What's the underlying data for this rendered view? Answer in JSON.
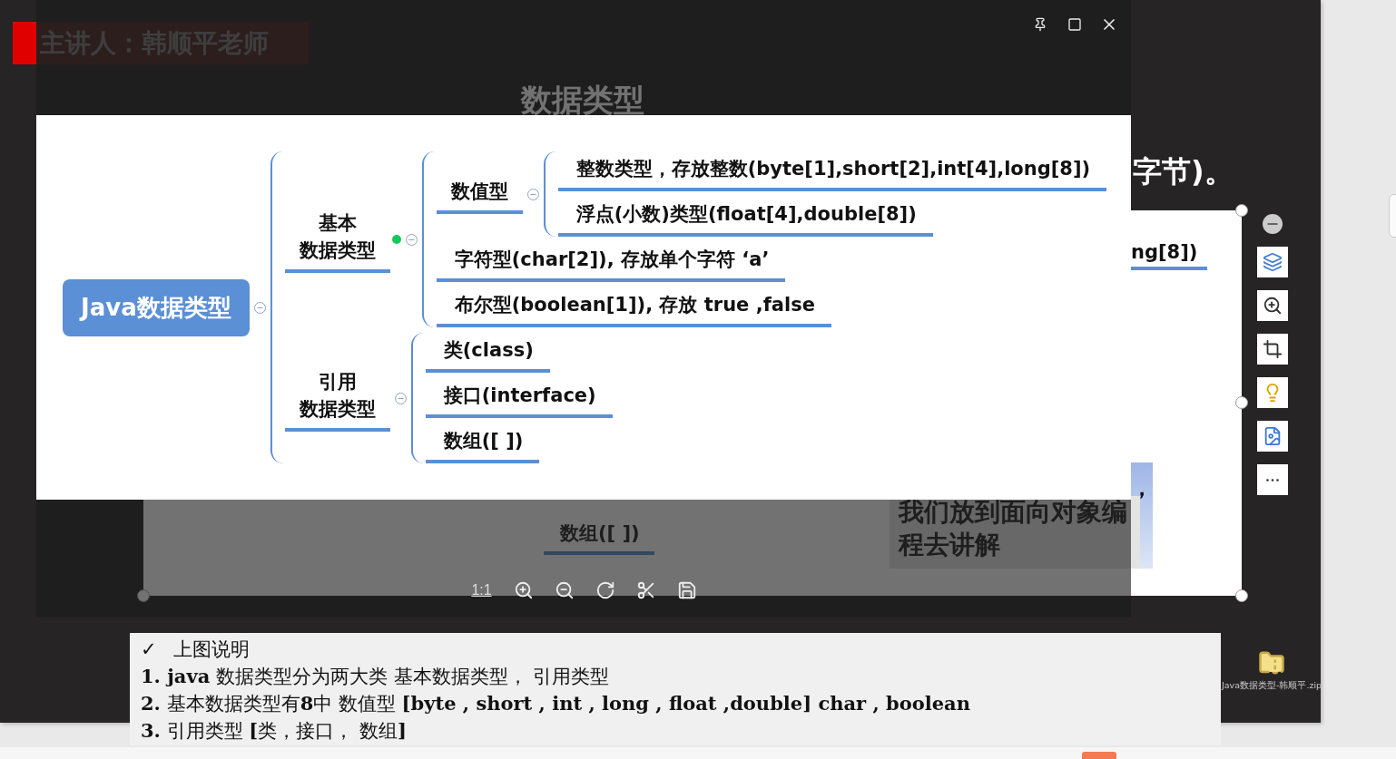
{
  "slide": {
    "presenter": "主讲人：韩顺平老师",
    "title": "数据类型",
    "side_text": "字节)。",
    "embedded_image": {
      "node_text": "ng[8])",
      "comma": "，",
      "dim_node": "数组([ ])",
      "note": "我们放到面向对象编程去讲解"
    },
    "attachment": {
      "filename": "Java数据类型-韩顺平.zip"
    },
    "notes": {
      "marker": "✓",
      "heading": "上图说明",
      "lines": [
        "**1. java** 数据类型分为两大类 基本数据类型，  引用类型",
        "**2.** 基本数据类型有**8**中  数值型 **[byte , short , int , long , float ,double] char , boolean**",
        "**3.** 引用类型 **[**类，接口，  数组**]**"
      ]
    }
  },
  "viewer": {
    "zoom_label": "1:1",
    "mindmap": {
      "label": "Java数据类型",
      "expanded": true,
      "children": [
        {
          "label_lines": [
            "基本",
            "数据类型"
          ],
          "expanded": true,
          "children": [
            {
              "label": "数值型",
              "expanded": true,
              "children": [
                {
                  "label": "整数类型，存放整数(byte[1],short[2],int[4],long[8])"
                },
                {
                  "label": "浮点(小数)类型(float[4],double[8])"
                }
              ]
            },
            {
              "label": "字符型(char[2]), 存放单个字符  ‘a’"
            },
            {
              "label": "布尔型(boolean[1]), 存放 true ,false"
            }
          ]
        },
        {
          "label_lines": [
            "引用",
            "数据类型"
          ],
          "expanded": true,
          "children": [
            {
              "label": "类(class)"
            },
            {
              "label": "接口(interface)"
            },
            {
              "label": "数组([ ])"
            }
          ]
        }
      ]
    }
  }
}
